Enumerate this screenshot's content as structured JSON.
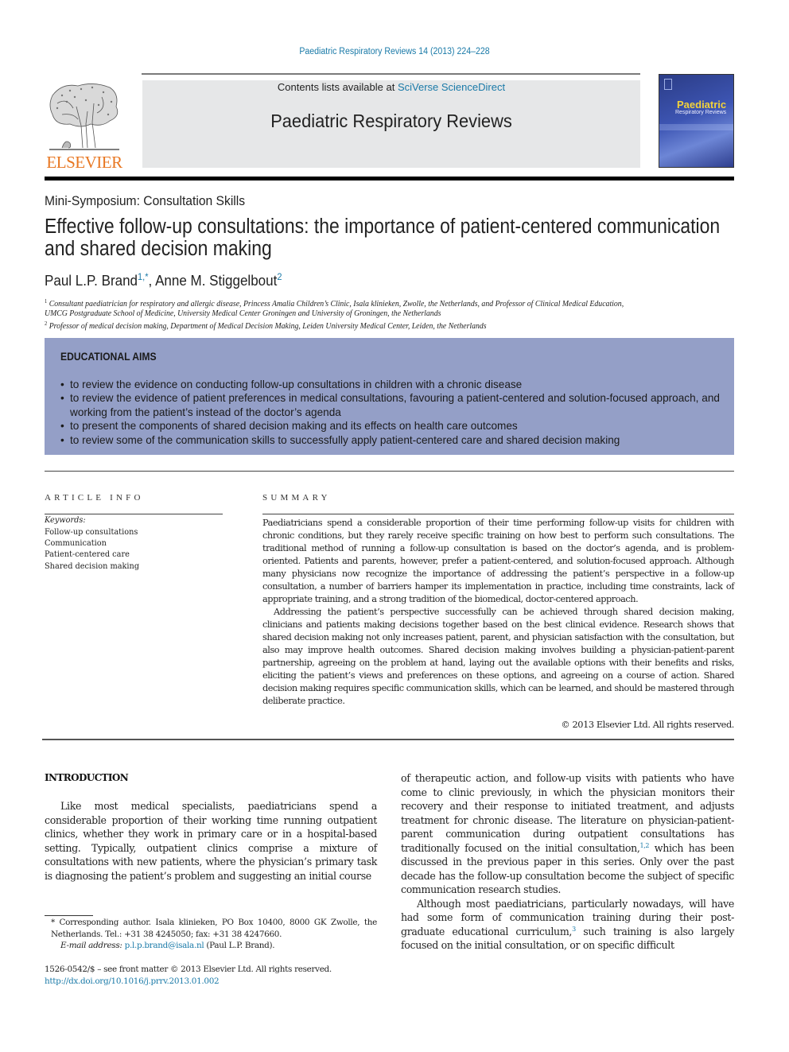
{
  "header": {
    "journal_ref": "Paediatric Respiratory Reviews 14 (2013) 224–228",
    "contents_prefix": "Contents lists available at ",
    "contents_link": "SciVerse ScienceDirect",
    "journal_title": "Paediatric Respiratory Reviews",
    "publisher_logo_text": "ELSEVIER",
    "cover_title": "Paediatric",
    "cover_subtitle": "Respiratory Reviews"
  },
  "article": {
    "section": "Mini-Symposium: Consultation Skills",
    "title": "Effective follow-up consultations: the importance of patient-centered communication and shared decision making",
    "authors": [
      {
        "name": "Paul L.P. Brand",
        "sup": "1,*"
      },
      {
        "name": "Anne M. Stiggelbout",
        "sup": "2"
      }
    ],
    "affiliations": [
      {
        "sup": "1",
        "line1": "Consultant paediatrician for respiratory and allergic disease, Princess Amalia Children’s Clinic, Isala klinieken, Zwolle, the Netherlands, and Professor of Clinical Medical Education,",
        "line2": "UMCG Postgraduate School of Medicine, University Medical Center Groningen and University of Groningen, the Netherlands"
      },
      {
        "sup": "2",
        "line1": "Professor of medical decision making, Department of Medical Decision Making, Leiden University Medical Center, Leiden, the Netherlands"
      }
    ]
  },
  "aims": {
    "heading": "EDUCATIONAL AIMS",
    "color": "#949fc7",
    "items": [
      "to review the evidence on conducting follow-up consultations in children with a chronic disease",
      "to review the evidence of patient preferences in medical consultations, favouring a patient-centered and solution-focused approach, and working from the patient’s instead of the doctor’s agenda",
      "to present the components of shared decision making and its effects on health care outcomes",
      "to review some of the communication skills to successfully apply patient-centered care and shared decision making"
    ]
  },
  "article_info": {
    "heading": "ARTICLE INFO",
    "keywords_label": "Keywords:",
    "keywords": [
      "Follow-up consultations",
      "Communication",
      "Patient-centered care",
      "Shared decision making"
    ]
  },
  "summary": {
    "heading": "SUMMARY",
    "paragraphs": [
      "Paediatricians spend a considerable proportion of their time performing follow-up visits for children with chronic conditions, but they rarely receive specific training on how best to perform such consultations. The traditional method of running a follow-up consultation is based on the doctor’s agenda, and is problem-oriented. Patients and parents, however, prefer a patient-centered, and solution-focused approach. Although many physicians now recognize the importance of addressing the patient’s perspective in a follow-up consultation, a number of barriers hamper its implementation in practice, including time constraints, lack of appropriate training, and a strong tradition of the biomedical, doctor-centered approach.",
      "Addressing the patient’s perspective successfully can be achieved through shared decision making, clinicians and patients making decisions together based on the best clinical evidence. Research shows that shared decision making not only increases patient, parent, and physician satisfaction with the consultation, but also may improve health outcomes. Shared decision making involves building a physician-patient-parent partnership, agreeing on the problem at hand, laying out the available options with their benefits and risks, eliciting the patient’s views and preferences on these options, and agreeing on a course of action. Shared decision making requires specific communication skills, which can be learned, and should be mastered through deliberate practice."
    ],
    "copyright": "© 2013 Elsevier Ltd. All rights reserved."
  },
  "introduction": {
    "heading": "INTRODUCTION",
    "left_paragraph": "Like most medical specialists, paediatricians spend a considerable proportion of their working time running outpatient clinics, whether they work in primary care or in a hospital-based setting. Typically, outpatient clinics comprise a mixture of consultations with new patients, where the physician’s primary task is diagnosing the patient’s problem and suggesting an initial course",
    "right_p1_a": "of therapeutic action, and follow-up visits with patients who have come to clinic previously, in which the physician monitors their recovery and their response to initiated treatment, and adjusts treatment for chronic disease. The literature on physician-patient-parent communication during outpatient consultations has traditionally focused on the initial consultation,",
    "right_p1_ref": "1,2",
    "right_p1_b": " which has been discussed in the previous paper in this series. Only over the past decade has the follow-up consultation become the subject of specific communication research studies.",
    "right_p2_a": "Although most paediatricians, particularly nowadays, will have had some form of communication training during their post-graduate educational curriculum,",
    "right_p2_ref": "3",
    "right_p2_b": " such training is also largely focused on the initial consultation, or on specific difficult"
  },
  "footnotes": {
    "corresponding": "* Corresponding author. Isala klinieken, PO Box 10400, 8000 GK Zwolle, the Netherlands. Tel.: +31 38 4245050; fax: +31 38 4247660.",
    "email_label": "E-mail address:",
    "email": "p.l.p.brand@isala.nl",
    "email_suffix": " (Paul L.P. Brand).",
    "front_matter": "1526-0542/$ – see front matter © 2013 Elsevier Ltd. All rights reserved.",
    "doi": "http://dx.doi.org/10.1016/j.prrv.2013.01.002"
  },
  "colors": {
    "link": "#1a7aa8",
    "elsevier_orange": "#e87722",
    "header_box": "#e6e7e8"
  }
}
